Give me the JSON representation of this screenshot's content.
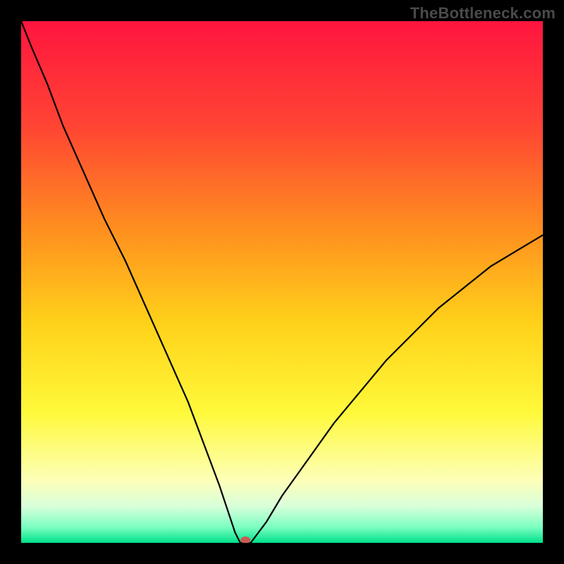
{
  "watermark": "TheBottleneck.com",
  "chart_data": {
    "type": "line",
    "title": "",
    "xlabel": "",
    "ylabel": "",
    "xlim": [
      0,
      100
    ],
    "ylim": [
      0,
      100
    ],
    "grid": false,
    "legend": false,
    "background_gradient": {
      "stops": [
        {
          "offset": 0.0,
          "color": "#ff153f"
        },
        {
          "offset": 0.2,
          "color": "#ff4433"
        },
        {
          "offset": 0.4,
          "color": "#ff8f1f"
        },
        {
          "offset": 0.58,
          "color": "#ffd21a"
        },
        {
          "offset": 0.75,
          "color": "#fff93a"
        },
        {
          "offset": 0.88,
          "color": "#fdffb8"
        },
        {
          "offset": 0.93,
          "color": "#d8ffda"
        },
        {
          "offset": 0.97,
          "color": "#7bffc1"
        },
        {
          "offset": 1.0,
          "color": "#00e08a"
        }
      ]
    },
    "series": [
      {
        "name": "curve",
        "color": "#000000",
        "x": [
          0,
          2,
          5,
          8,
          12,
          16,
          20,
          24,
          28,
          32,
          35,
          38,
          40,
          41,
          42,
          44,
          47,
          50,
          55,
          60,
          65,
          70,
          75,
          80,
          85,
          90,
          95,
          100
        ],
        "values": [
          100,
          95,
          88,
          80,
          71,
          62,
          54,
          45,
          36,
          27,
          19,
          11,
          5,
          2,
          0,
          0,
          4,
          9,
          16,
          23,
          29,
          35,
          40,
          45,
          49,
          53,
          56,
          59
        ]
      }
    ],
    "marker": {
      "name": "min-point",
      "x": 43,
      "y": 0,
      "color": "#cc5a52",
      "rx": 7,
      "ry": 5
    }
  }
}
